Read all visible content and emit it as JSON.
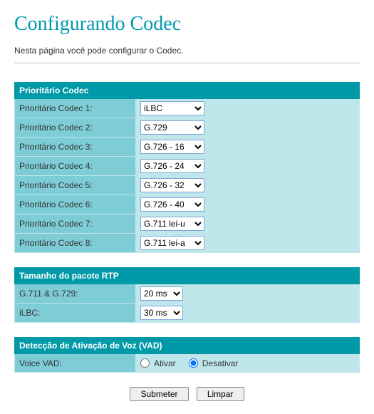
{
  "title": "Configurando Codec",
  "intro": "Nesta página você pode configurar o Codec.",
  "section_codec": {
    "header": "Prioritário Codec",
    "rows": [
      {
        "label": "Prioritário Codec 1:",
        "value": "iLBC"
      },
      {
        "label": "Prioritário Codec 2:",
        "value": "G.729"
      },
      {
        "label": "Prioritário Codec 3:",
        "value": "G.726 - 16"
      },
      {
        "label": "Prioritário Codec 4:",
        "value": "G.726 - 24"
      },
      {
        "label": "Prioritário Codec 5:",
        "value": "G.726 - 32"
      },
      {
        "label": "Prioritário Codec 6:",
        "value": "G.726 - 40"
      },
      {
        "label": "Prioritário Codec 7:",
        "value": "G.711 lei-u"
      },
      {
        "label": "Prioritário Codec 8:",
        "value": "G.711 lei-a"
      }
    ]
  },
  "section_rtp": {
    "header": "Tamanho do pacote RTP",
    "rows": [
      {
        "label": "G.711 & G.729:",
        "value": "20 ms"
      },
      {
        "label": "iLBC:",
        "value": "30 ms"
      }
    ]
  },
  "section_vad": {
    "header": "Detecção de Ativação de Voz (VAD)",
    "label": "Voice VAD:",
    "options": {
      "on": "Ativar",
      "off": "Desativar"
    },
    "selected": "off"
  },
  "buttons": {
    "submit": "Submeter",
    "reset": "Limpar"
  }
}
